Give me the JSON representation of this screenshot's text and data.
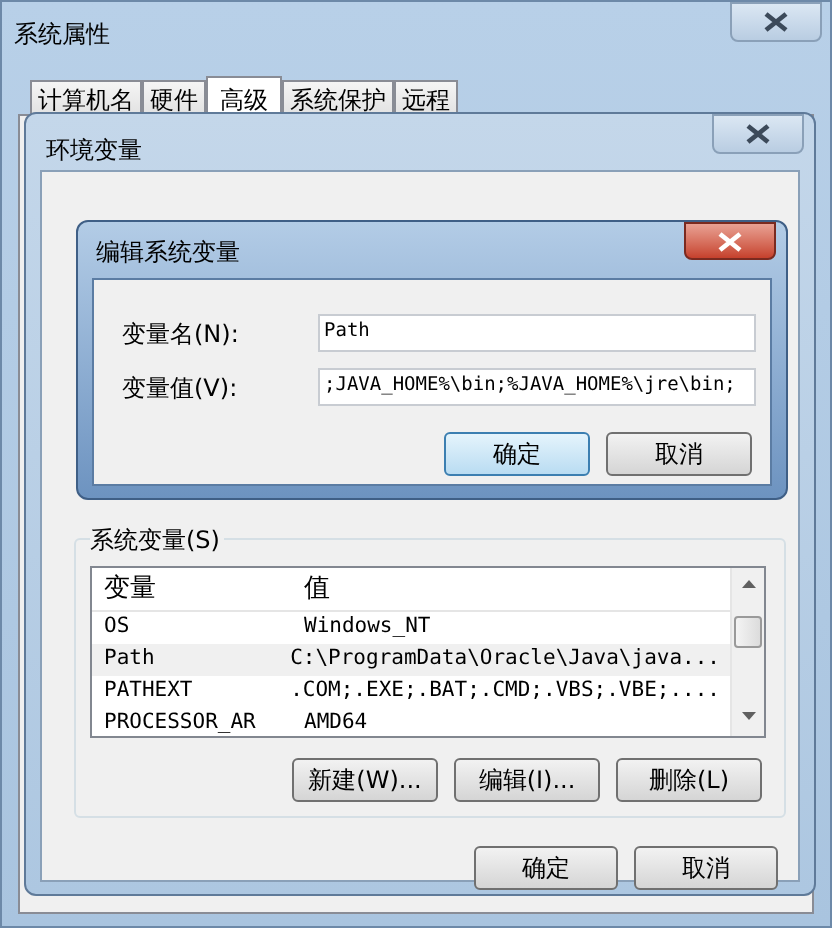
{
  "outer_window": {
    "title": "系统属性"
  },
  "tabs": [
    {
      "label": "计算机名",
      "selected": false
    },
    {
      "label": "硬件",
      "selected": false
    },
    {
      "label": "高级",
      "selected": true
    },
    {
      "label": "系统保护",
      "selected": false
    },
    {
      "label": "远程",
      "selected": false
    }
  ],
  "env_window": {
    "title": "环境变量",
    "system_variables": {
      "label": "系统变量(S)",
      "columns": [
        "变量",
        "值"
      ],
      "rows": [
        {
          "name": "OS",
          "value": "Windows_NT",
          "selected": false
        },
        {
          "name": "Path",
          "value": "C:\\ProgramData\\Oracle\\Java\\java...",
          "selected": true
        },
        {
          "name": "PATHEXT",
          "value": ".COM;.EXE;.BAT;.CMD;.VBS;.VBE;....",
          "selected": false
        },
        {
          "name": "PROCESSOR_AR",
          "value": "AMD64",
          "selected": false
        }
      ],
      "buttons": [
        "新建(W)...",
        "编辑(I)...",
        "删除(L)"
      ]
    },
    "buttons": [
      "确定",
      "取消"
    ]
  },
  "edit_dialog": {
    "title": "编辑系统变量",
    "fields": [
      {
        "label": "变量名(N):",
        "value": "Path"
      },
      {
        "label": "变量值(V):",
        "value": ";JAVA_HOME%\\bin;%JAVA_HOME%\\jre\\bin;"
      }
    ],
    "buttons": [
      {
        "label": "确定",
        "selected": true
      },
      {
        "label": "取消",
        "selected": false
      }
    ]
  }
}
